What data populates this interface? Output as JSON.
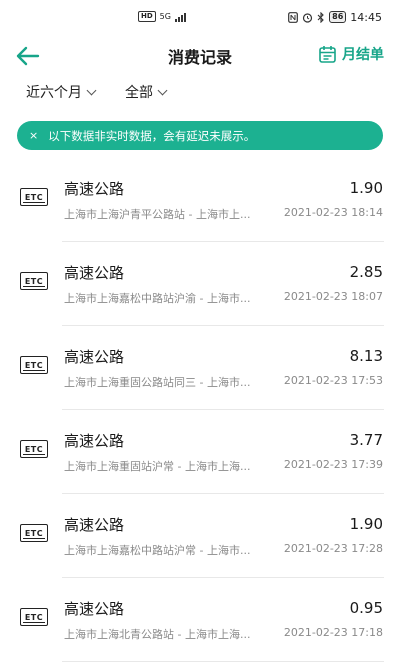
{
  "status_bar": {
    "network": "HD",
    "signal_type": "5G",
    "battery": "86",
    "time": "14:45",
    "icons": [
      "nfc-icon",
      "alarm-icon",
      "bluetooth-icon",
      "battery-icon"
    ]
  },
  "header": {
    "title": "消费记录",
    "monthly_bill_label": "月结单",
    "accent_color": "#17a589"
  },
  "filters": {
    "period_label": "近六个月",
    "type_label": "全部"
  },
  "notice": {
    "close_symbol": "×",
    "text": "以下数据非实时数据，会有延迟未展示。",
    "background_color": "#1cb191"
  },
  "records": [
    {
      "icon_text": "ETC",
      "name": "高速公路",
      "amount": "1.90",
      "detail": "上海市上海沪青平公路站 - 上海市上...",
      "time": "2021-02-23 18:14"
    },
    {
      "icon_text": "ETC",
      "name": "高速公路",
      "amount": "2.85",
      "detail": "上海市上海嘉松中路站沪渝 - 上海市...",
      "time": "2021-02-23 18:07"
    },
    {
      "icon_text": "ETC",
      "name": "高速公路",
      "amount": "8.13",
      "detail": "上海市上海重固公路站同三 - 上海市...",
      "time": "2021-02-23 17:53"
    },
    {
      "icon_text": "ETC",
      "name": "高速公路",
      "amount": "3.77",
      "detail": "上海市上海重固站沪常 - 上海市上海...",
      "time": "2021-02-23 17:39"
    },
    {
      "icon_text": "ETC",
      "name": "高速公路",
      "amount": "1.90",
      "detail": "上海市上海嘉松中路站沪常 - 上海市...",
      "time": "2021-02-23 17:28"
    },
    {
      "icon_text": "ETC",
      "name": "高速公路",
      "amount": "0.95",
      "detail": "上海市上海北青公路站 - 上海市上海...",
      "time": "2021-02-23 17:18"
    }
  ]
}
